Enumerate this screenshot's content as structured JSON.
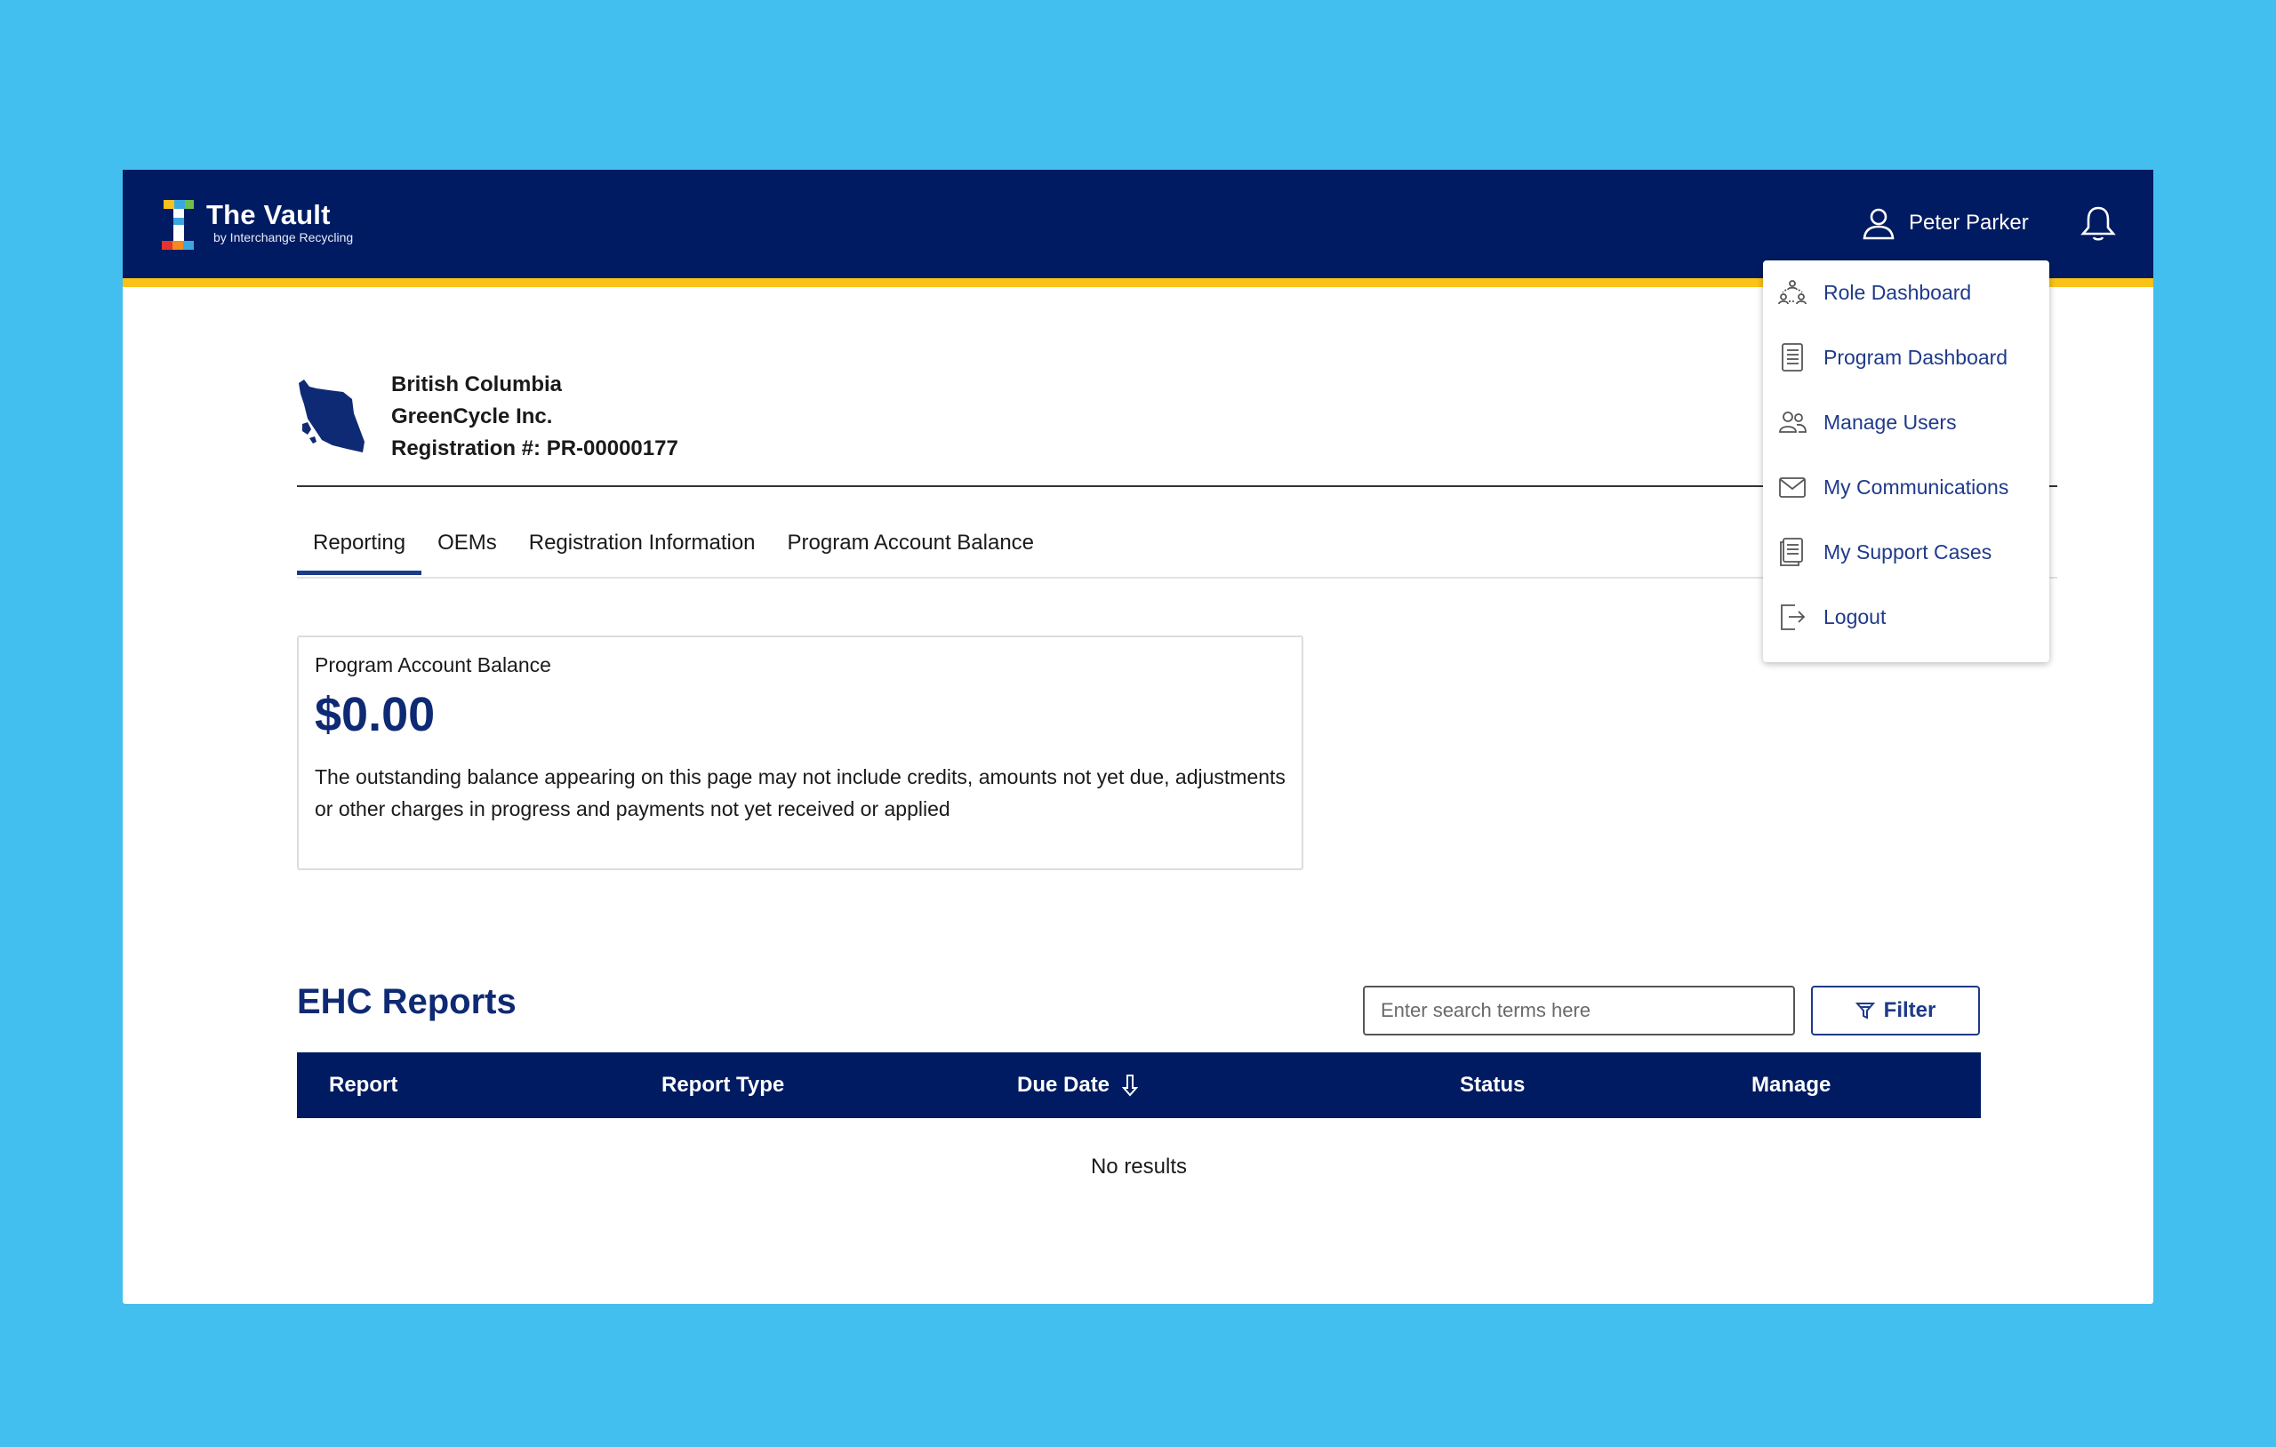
{
  "app": {
    "title": "The Vault",
    "subtitle": "by Interchange Recycling"
  },
  "user": {
    "name": "Peter Parker"
  },
  "header": {
    "province": "British Columbia",
    "company": "GreenCycle Inc.",
    "registration": "Registration #: PR-00000177"
  },
  "tabs": [
    {
      "label": "Reporting",
      "active": true
    },
    {
      "label": "OEMs"
    },
    {
      "label": "Registration Information"
    },
    {
      "label": "Program Account Balance"
    }
  ],
  "balance": {
    "label": "Program Account Balance",
    "amount": "$0.00",
    "note": "The outstanding balance appearing on this page may not include credits, amounts not yet due, adjustments or other charges in progress and payments not yet received or applied"
  },
  "reports": {
    "title": "EHC Reports",
    "search_placeholder": "Enter search terms here",
    "filter_label": "Filter",
    "columns": [
      "Report",
      "Report Type",
      "Due Date",
      "Status",
      "Manage"
    ],
    "empty_text": "No results"
  },
  "user_menu": {
    "items": [
      {
        "label": "Role Dashboard",
        "icon": "role-dashboard-icon"
      },
      {
        "label": "Program Dashboard",
        "icon": "list-document-icon"
      },
      {
        "label": "Manage Users",
        "icon": "users-icon"
      },
      {
        "label": "My Communications",
        "icon": "envelope-icon"
      },
      {
        "label": "My Support Cases",
        "icon": "support-cases-icon"
      },
      {
        "label": "Logout",
        "icon": "logout-icon"
      }
    ]
  },
  "colors": {
    "page_background": "#42bfee",
    "navy": "#001b62",
    "accent_yellow": "#fbc218",
    "link_blue": "#1e3a8a"
  }
}
